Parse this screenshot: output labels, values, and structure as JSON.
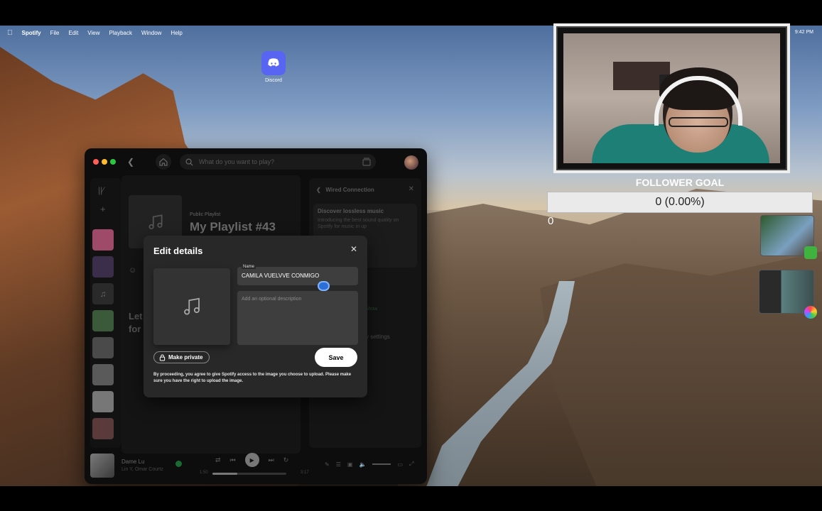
{
  "menubar": {
    "app_name": "Spotify",
    "items": [
      "File",
      "Edit",
      "View",
      "Playback",
      "Window",
      "Help"
    ],
    "clock": "9:42 PM"
  },
  "desktop": {
    "icons": [
      {
        "label": "Discord",
        "icon": "discord-icon"
      }
    ]
  },
  "spotify": {
    "search_placeholder": "What do you want to play?",
    "playlist_kind": "Public Playlist",
    "playlist_title": "My Playlist #43",
    "lets_find_line1": "Let",
    "lets_find_line2": "for",
    "right_panel": {
      "title": "Wired Connection",
      "card_title": "Discover lossless music",
      "card_text": "Introducing the best sound quality on Spotify for music in up",
      "show_link": "show",
      "quality_settings": "ity settings"
    },
    "player": {
      "song": "Dame Lu",
      "artist": "Lin Y, Omar Courtz",
      "elapsed": "1:50",
      "duration": "3:17",
      "progress": 0.34
    }
  },
  "modal": {
    "title": "Edit details",
    "name_label": "Name",
    "name_value": "CAMILA VUELVVE CONMIGO",
    "description_placeholder": "Add an optional description",
    "make_private_label": "Make private",
    "save_label": "Save",
    "legal_text": "By proceeding, you agree to give Spotify access to the image you choose to upload. Please make sure you have the right to upload the image."
  },
  "overlay": {
    "goal_label": "FOLLOWER GOAL",
    "goal_value": "0 (0.00%)",
    "goal_min": "0",
    "goal_max": "100",
    "goal_fraction": 0.0
  },
  "colors": {
    "spotify_green": "#1db954",
    "modal_bg": "#282828",
    "discord_blurple": "#5865f2"
  }
}
